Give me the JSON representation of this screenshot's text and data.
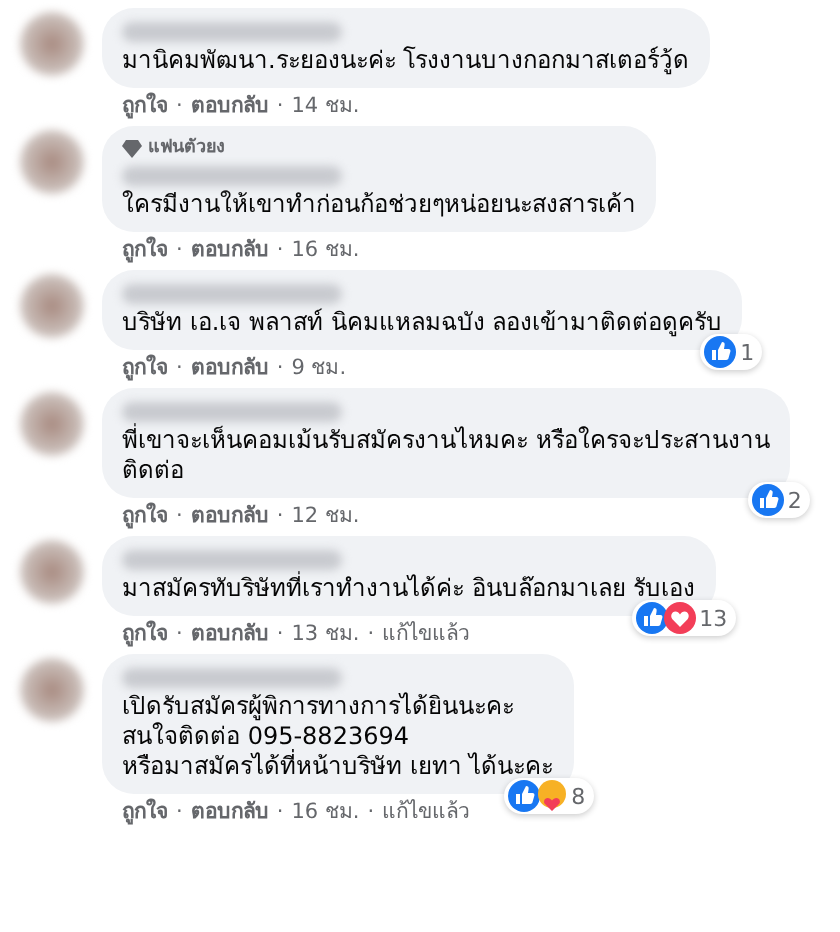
{
  "comments": [
    {
      "text": "มานิคมพัฒนา.ระยองนะค่ะ โรงงานบางกอกมาสเตอร์วู้ด",
      "meta": [
        {
          "kind": "link",
          "text": "ถูกใจ"
        },
        {
          "kind": "dot",
          "text": "·"
        },
        {
          "kind": "link",
          "text": "ตอบกลับ"
        },
        {
          "kind": "dot",
          "text": "·"
        },
        {
          "kind": "time",
          "text": "14 ชม."
        }
      ]
    },
    {
      "badge": "แฟนตัวยง",
      "text": "ใครมีงานให้เขาทำก่อนก้อช่วยๆหน่อยนะสงสารเค้า",
      "meta": [
        {
          "kind": "link",
          "text": "ถูกใจ"
        },
        {
          "kind": "dot",
          "text": "·"
        },
        {
          "kind": "link",
          "text": "ตอบกลับ"
        },
        {
          "kind": "dot",
          "text": "·"
        },
        {
          "kind": "time",
          "text": "16 ชม."
        }
      ]
    },
    {
      "text": "บริษัท เอ.เจ พลาสท์ นิคมแหลมฉบัง ลองเข้ามาติดต่อดูครับ",
      "reactions": {
        "icons": [
          {
            "kind": "like"
          }
        ],
        "count": "1"
      },
      "meta": [
        {
          "kind": "link",
          "text": "ถูกใจ"
        },
        {
          "kind": "dot",
          "text": "·"
        },
        {
          "kind": "link",
          "text": "ตอบกลับ"
        },
        {
          "kind": "dot",
          "text": "·"
        },
        {
          "kind": "time",
          "text": "9 ชม."
        }
      ]
    },
    {
      "text": "พี่เขาจะเห็นคอมเม้นรับสมัครงานไหมคะ หรือใครจะประสานงาน\nติดต่อ",
      "reactions": {
        "icons": [
          {
            "kind": "like"
          }
        ],
        "count": "2"
      },
      "meta": [
        {
          "kind": "link",
          "text": "ถูกใจ"
        },
        {
          "kind": "dot",
          "text": "·"
        },
        {
          "kind": "link",
          "text": "ตอบกลับ"
        },
        {
          "kind": "dot",
          "text": "·"
        },
        {
          "kind": "time",
          "text": "12 ชม."
        }
      ]
    },
    {
      "text": "มาสมัครทับริษัทที่เราทำงานได้ค่ะ อินบล๊อกมาเลย รับเอง",
      "reactions": {
        "icons": [
          {
            "kind": "like"
          },
          {
            "kind": "love"
          }
        ],
        "count": "13"
      },
      "meta": [
        {
          "kind": "link",
          "text": "ถูกใจ"
        },
        {
          "kind": "dot",
          "text": "·"
        },
        {
          "kind": "link",
          "text": "ตอบกลับ"
        },
        {
          "kind": "dot",
          "text": "·"
        },
        {
          "kind": "time",
          "text": "13 ชม."
        },
        {
          "kind": "dot",
          "text": "·"
        },
        {
          "kind": "time",
          "text": "แก้ไขแล้ว"
        }
      ]
    },
    {
      "text": "เปิดรับสมัครผู้พิการทางการได้ยินนะคะ\nสนใจติดต่อ 095-8823694\nหรือมาสมัครได้ที่หน้าบริษัท เยทา ได้นะคะ",
      "reactions": {
        "icons": [
          {
            "kind": "like"
          },
          {
            "kind": "care"
          }
        ],
        "count": "8"
      },
      "meta": [
        {
          "kind": "link",
          "text": "ถูกใจ"
        },
        {
          "kind": "dot",
          "text": "·"
        },
        {
          "kind": "link",
          "text": "ตอบกลับ"
        },
        {
          "kind": "dot",
          "text": "·"
        },
        {
          "kind": "time",
          "text": "16 ชม."
        },
        {
          "kind": "dot",
          "text": "·"
        },
        {
          "kind": "time",
          "text": "แก้ไขแล้ว"
        }
      ]
    }
  ]
}
